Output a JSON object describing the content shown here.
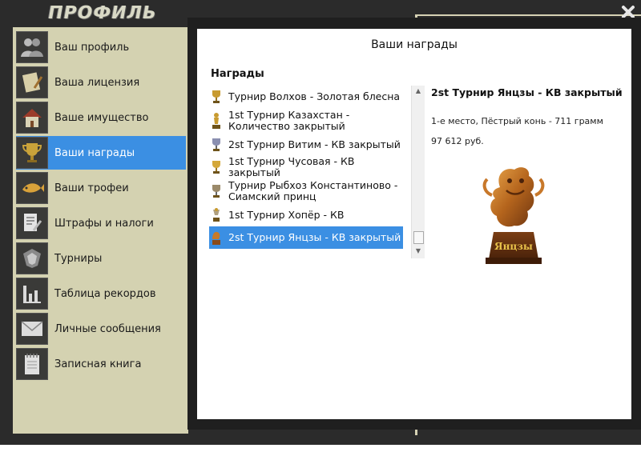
{
  "window": {
    "title": "ПРОФИЛЬ",
    "close_label": "X"
  },
  "sidebar": {
    "items": [
      {
        "label": "Ваш профиль",
        "icon": "users-icon"
      },
      {
        "label": "Ваша лицензия",
        "icon": "license-icon"
      },
      {
        "label": "Ваше имущество",
        "icon": "house-icon"
      },
      {
        "label": "Ваши награды",
        "icon": "trophy-cup-icon",
        "active": true
      },
      {
        "label": "Ваши трофеи",
        "icon": "fish-icon"
      },
      {
        "label": "Штрафы и налоги",
        "icon": "document-pen-icon"
      },
      {
        "label": "Турниры",
        "icon": "tournament-icon"
      },
      {
        "label": "Таблица рекордов",
        "icon": "bar-chart-icon"
      },
      {
        "label": "Личные сообщения",
        "icon": "envelope-icon"
      },
      {
        "label": "Записная книга",
        "icon": "notebook-icon"
      }
    ]
  },
  "panel": {
    "title": "Ваши награды",
    "section_label": "Награды",
    "awards": [
      {
        "label": "Турнир Волхов - Золотая блесна"
      },
      {
        "label": "1st Турнир Казахстан - Количество закрытый"
      },
      {
        "label": "2st Турнир Витим - КВ закрытый"
      },
      {
        "label": "1st Турнир Чусовая - КВ закрытый"
      },
      {
        "label": "Турнир Рыбхоз Константиново - Сиамский принц"
      },
      {
        "label": "1st Турнир Хопёр - КВ"
      },
      {
        "label": "2st Турнир Янцзы - КВ закрытый",
        "selected": true
      }
    ],
    "detail": {
      "title": "2st Турнир Янцзы - КВ закрытый",
      "place": "1-е место, Пёстрый конь - 711 грамм",
      "prize": "97 612 руб.",
      "figure_label": "Янцзы"
    }
  },
  "colors": {
    "accent": "#3b8fe3",
    "sidebar_bg": "#d4d2b1",
    "frame": "#2b2b2b"
  }
}
